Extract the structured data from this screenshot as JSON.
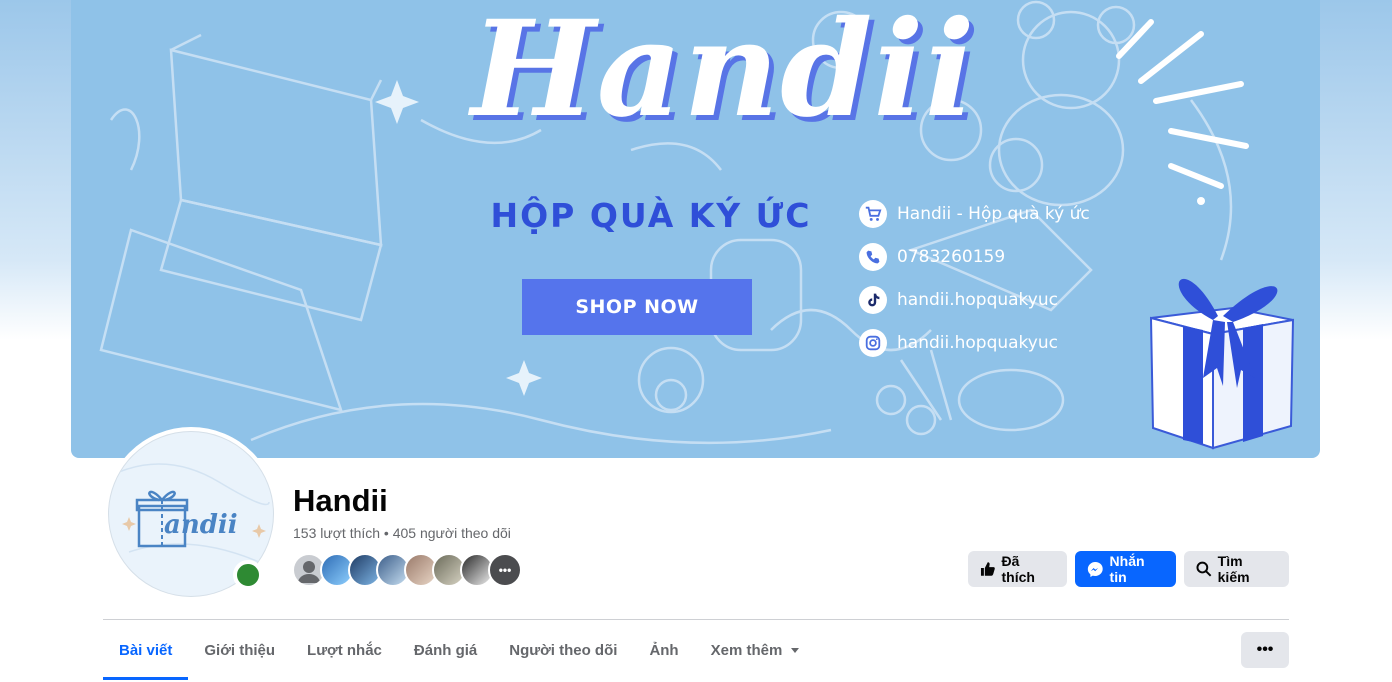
{
  "cover": {
    "brand": "Handii",
    "tagline": "HỘP QUÀ KÝ ỨC",
    "cta": "SHOP NOW",
    "contacts": [
      {
        "icon": "cart-icon",
        "text": "Handii - Hộp quà ký ức"
      },
      {
        "icon": "phone-icon",
        "text": "0783260159"
      },
      {
        "icon": "tiktok-icon",
        "text": "handii.hopquakyuc"
      },
      {
        "icon": "instagram-icon",
        "text": "handii.hopquakyuc"
      }
    ],
    "colors": {
      "background": "#8fc2e8",
      "accent": "#2f4fd8",
      "button": "#5574ec"
    }
  },
  "profile": {
    "avatar_text": "andii",
    "name": "Handii",
    "stats": "153 lượt thích • 405 người theo dõi",
    "follower_count_shown": 8,
    "online": true
  },
  "actions": {
    "liked": "Đã thích",
    "message": "Nhắn tin",
    "search": "Tìm kiếm"
  },
  "tabs": [
    {
      "label": "Bài viết",
      "active": true
    },
    {
      "label": "Giới thiệu",
      "active": false
    },
    {
      "label": "Lượt nhắc",
      "active": false
    },
    {
      "label": "Đánh giá",
      "active": false
    },
    {
      "label": "Người theo dõi",
      "active": false
    },
    {
      "label": "Ảnh",
      "active": false
    },
    {
      "label": "Xem thêm",
      "active": false
    }
  ],
  "more_menu": "•••",
  "colors": {
    "facebook_blue": "#0866ff",
    "button_gray": "#e4e6eb",
    "online_green": "#2e8a33"
  }
}
